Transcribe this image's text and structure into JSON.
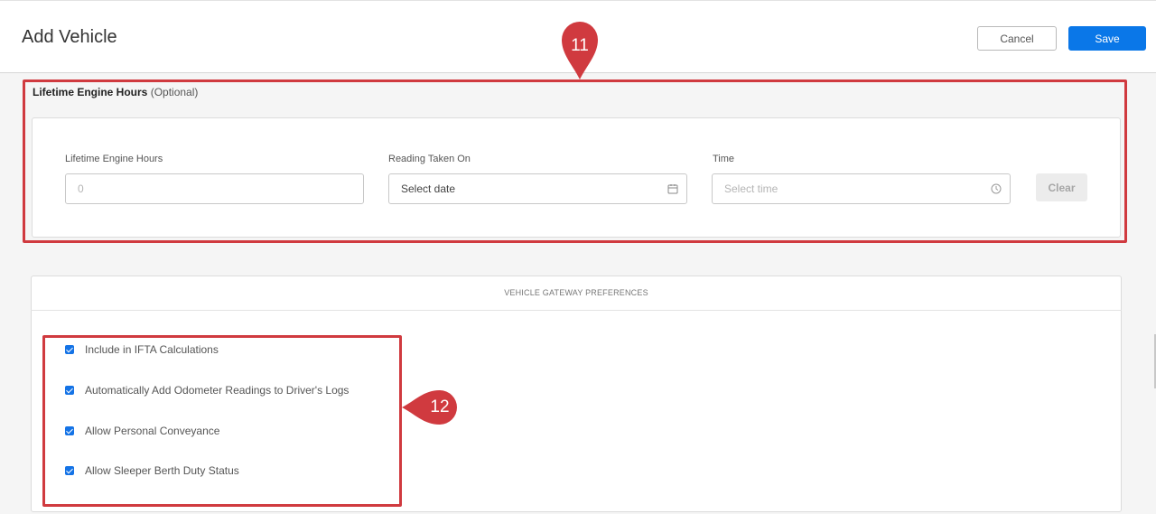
{
  "header": {
    "title": "Add Vehicle",
    "cancel_label": "Cancel",
    "save_label": "Save"
  },
  "engine_hours": {
    "section_title": "Lifetime Engine Hours",
    "section_optional": "(Optional)",
    "fields": {
      "hours_label": "Lifetime Engine Hours",
      "hours_placeholder": "0",
      "date_label": "Reading Taken On",
      "date_value": "Select date",
      "time_label": "Time",
      "time_placeholder": "Select time"
    },
    "clear_label": "Clear"
  },
  "gateway": {
    "header": "VEHICLE GATEWAY PREFERENCES",
    "options": [
      {
        "label": "Include in IFTA Calculations",
        "checked": true
      },
      {
        "label": "Automatically Add Odometer Readings to Driver's Logs",
        "checked": true
      },
      {
        "label": "Allow Personal Conveyance",
        "checked": true
      },
      {
        "label": "Allow Sleeper Berth Duty Status",
        "checked": true
      }
    ]
  },
  "annotations": {
    "marker_11": "11",
    "marker_12": "12",
    "color": "#d03a3f"
  },
  "icons": {
    "date": "calendar-icon",
    "time": "clock-icon"
  }
}
